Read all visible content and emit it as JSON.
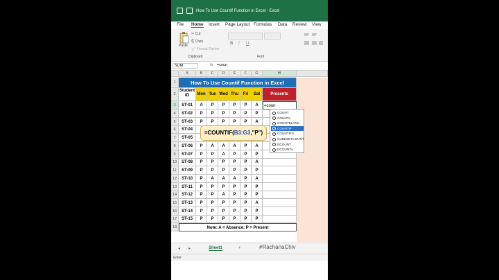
{
  "window": {
    "title": "How To Use Countif Function in Excel  -  Excel"
  },
  "menu": [
    "File",
    "Home",
    "Insert",
    "Page Layout",
    "Formulas",
    "Data",
    "Review",
    "View"
  ],
  "ribbon": {
    "cut": "Cut",
    "copy": "Copy",
    "paste": "Paste",
    "format_painter": "Format Painter",
    "clipboard": "Clipboard",
    "font": "Font"
  },
  "formula_bar": {
    "name_box": "SUM",
    "fx": "fx",
    "value": "=coun"
  },
  "columns": [
    "A",
    "B",
    "C",
    "D",
    "E",
    "F",
    "G",
    "H"
  ],
  "rows": [
    "1",
    "2",
    "3",
    "4",
    "5",
    "6",
    "7",
    "8",
    "9",
    "10",
    "11",
    "12",
    "13",
    "14",
    "15",
    "16",
    "17",
    "18"
  ],
  "sheet": {
    "title": "How To Use Countif Function in Excel",
    "student_id_header": "Student ID",
    "days": [
      "Mon",
      "Tue",
      "Wed",
      "Thu",
      "Fri",
      "Sat"
    ],
    "presents_header": "Presents",
    "students": [
      {
        "id": "ST-01",
        "marks": [
          "A",
          "P",
          "P",
          "P",
          "P",
          "A"
        ]
      },
      {
        "id": "ST-02",
        "marks": [
          "P",
          "P",
          "P",
          "P",
          "P",
          "P"
        ]
      },
      {
        "id": "ST-03",
        "marks": [
          "P",
          "P",
          "P",
          "P",
          "P",
          "A"
        ]
      },
      {
        "id": "ST-04",
        "marks": [
          "",
          "",
          "",
          "",
          "",
          ""
        ]
      },
      {
        "id": "ST-05",
        "marks": [
          "",
          "",
          "",
          "",
          "",
          ""
        ]
      },
      {
        "id": "ST-06",
        "marks": [
          "P",
          "A",
          "A",
          "A",
          "P",
          "A"
        ]
      },
      {
        "id": "ST-07",
        "marks": [
          "P",
          "P",
          "A",
          "P",
          "P",
          "P"
        ]
      },
      {
        "id": "ST-08",
        "marks": [
          "P",
          "P",
          "P",
          "P",
          "P",
          "A"
        ]
      },
      {
        "id": "ST-09",
        "marks": [
          "P",
          "P",
          "P",
          "P",
          "P",
          "P"
        ]
      },
      {
        "id": "ST-10",
        "marks": [
          "P",
          "A",
          "A",
          "A",
          "P",
          "A"
        ]
      },
      {
        "id": "ST-11",
        "marks": [
          "P",
          "P",
          "P",
          "P",
          "P",
          "P"
        ]
      },
      {
        "id": "ST-12",
        "marks": [
          "P",
          "P",
          "A",
          "P",
          "P",
          "P"
        ]
      },
      {
        "id": "ST-13",
        "marks": [
          "P",
          "P",
          "P",
          "P",
          "P",
          "A"
        ]
      },
      {
        "id": "ST-14",
        "marks": [
          "P",
          "P",
          "P",
          "P",
          "P",
          "P"
        ]
      },
      {
        "id": "ST-15",
        "marks": [
          "P",
          "P",
          "P",
          "P",
          "P",
          "P"
        ]
      }
    ],
    "editing_value": "=coun",
    "note": "Note: A = Absence; P = Present"
  },
  "tooltip": "Counts the n",
  "autocomplete": {
    "items": [
      "COUNT",
      "COUNTA",
      "COUNTBLANK",
      "COUNTIF",
      "COUNTIFS",
      "CUBESETCOUNT",
      "DCOUNT",
      "DCOUNTA"
    ],
    "selected": "COUNTIF"
  },
  "callout": {
    "prefix": "=COUNTIF(",
    "range": "B3:G3",
    "suffix": ",\"P\")"
  },
  "sheet_tab": "Sheet1",
  "add_sheet": "+",
  "watermark": "#RachanaChiv",
  "status": "Enter",
  "colors": {
    "excel_green": "#1e7145",
    "title_blue": "#1f6fb8",
    "header_yellow": "#f0d000",
    "presents_red": "#c0202b",
    "callout_bg": "#fdeec8",
    "selection_blue": "#2f6fbf"
  }
}
